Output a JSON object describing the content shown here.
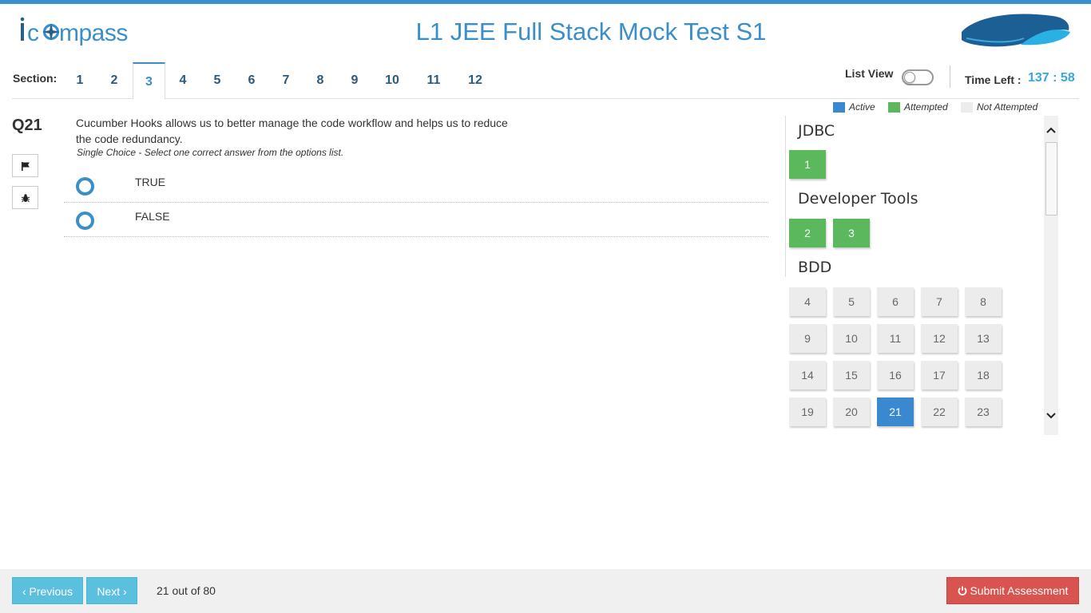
{
  "app": {
    "logo_text": "icompass",
    "title": "L1 JEE Full Stack Mock Test S1"
  },
  "sections": {
    "label": "Section:",
    "tabs": [
      "1",
      "2",
      "3",
      "4",
      "5",
      "6",
      "7",
      "8",
      "9",
      "10",
      "11",
      "12"
    ],
    "active": "3"
  },
  "header_right": {
    "list_view_label": "List View",
    "list_view_on": false,
    "time_left_label": "Time Left :",
    "time_left_value": "137 : 58"
  },
  "legend": {
    "active": "Active",
    "attempted": "Attempted",
    "not_attempted": "Not Attempted",
    "colors": {
      "active": "#3a88cf",
      "attempted": "#5cb85c",
      "not_attempted": "#ececec"
    }
  },
  "question": {
    "number": "Q21",
    "text_line1": "Cucumber Hooks allows us to better manage the code workflow and helps us to reduce",
    "text_line2": "the code redundancy.",
    "hint": "Single Choice - Select one correct answer from the options list.",
    "options": [
      "TRUE",
      "FALSE"
    ],
    "tools": [
      "flag-icon",
      "bug-icon"
    ]
  },
  "palette": {
    "groups": [
      {
        "title": "JDBC",
        "questions": [
          {
            "n": "1",
            "state": "attempted"
          }
        ]
      },
      {
        "title": "Developer Tools",
        "questions": [
          {
            "n": "2",
            "state": "attempted"
          },
          {
            "n": "3",
            "state": "attempted"
          }
        ]
      },
      {
        "title": "BDD",
        "questions": [
          {
            "n": "4",
            "state": "not_attempted"
          },
          {
            "n": "5",
            "state": "not_attempted"
          },
          {
            "n": "6",
            "state": "not_attempted"
          },
          {
            "n": "7",
            "state": "not_attempted"
          },
          {
            "n": "8",
            "state": "not_attempted"
          },
          {
            "n": "9",
            "state": "not_attempted"
          },
          {
            "n": "10",
            "state": "not_attempted"
          },
          {
            "n": "11",
            "state": "not_attempted"
          },
          {
            "n": "12",
            "state": "not_attempted"
          },
          {
            "n": "13",
            "state": "not_attempted"
          },
          {
            "n": "14",
            "state": "not_attempted"
          },
          {
            "n": "15",
            "state": "not_attempted"
          },
          {
            "n": "16",
            "state": "not_attempted"
          },
          {
            "n": "17",
            "state": "not_attempted"
          },
          {
            "n": "18",
            "state": "not_attempted"
          },
          {
            "n": "19",
            "state": "not_attempted"
          },
          {
            "n": "20",
            "state": "not_attempted"
          },
          {
            "n": "21",
            "state": "active"
          },
          {
            "n": "22",
            "state": "not_attempted"
          },
          {
            "n": "23",
            "state": "not_attempted"
          }
        ]
      }
    ]
  },
  "footer": {
    "previous_label": "Previous",
    "next_label": "Next",
    "progress": "21 out of 80",
    "submit_label": "Submit Assessment"
  }
}
